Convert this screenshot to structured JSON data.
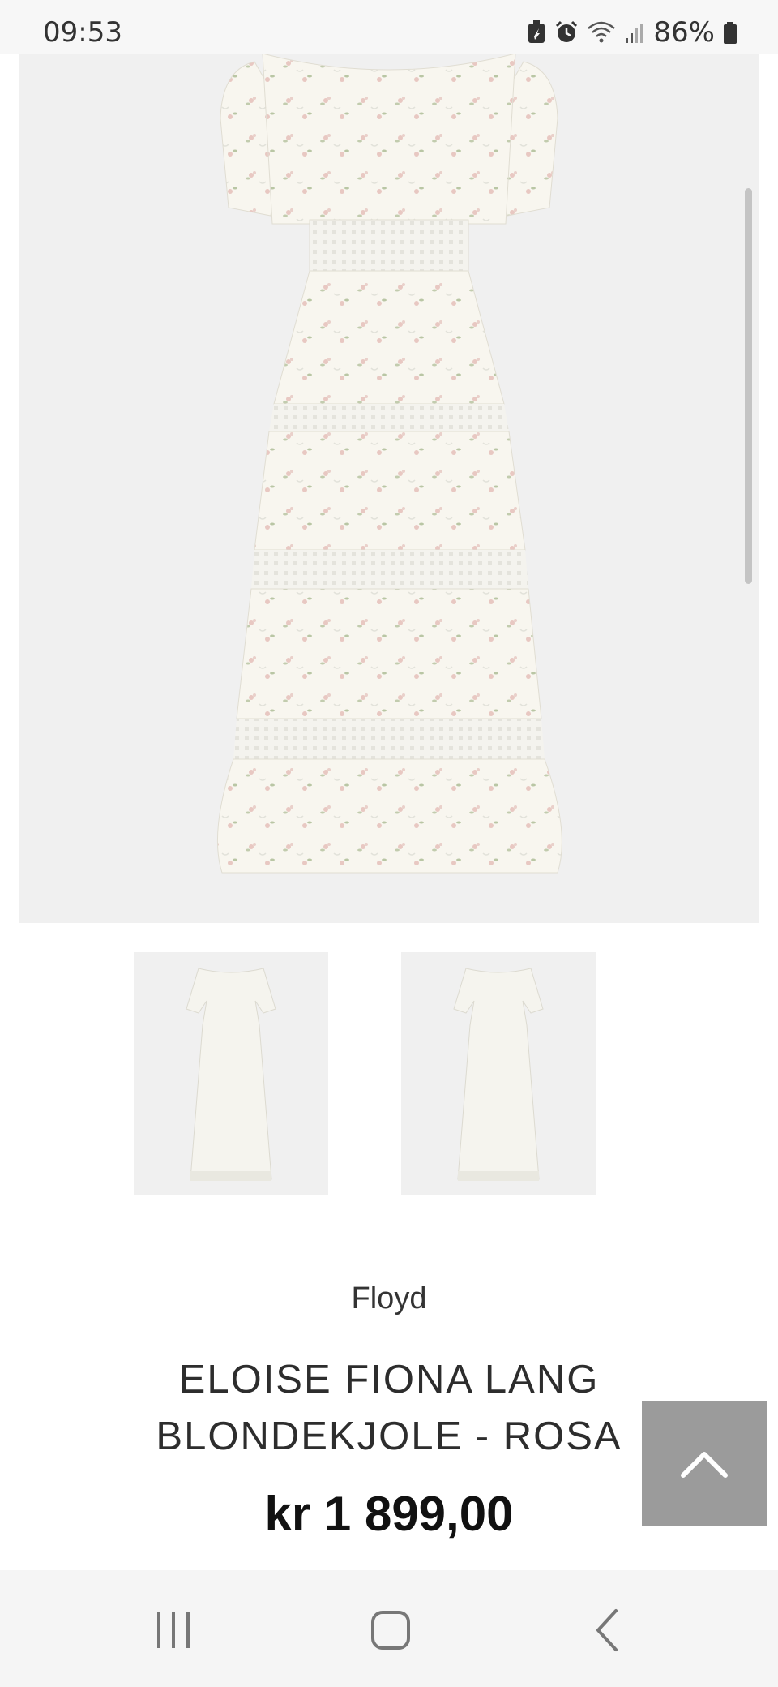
{
  "status_bar": {
    "time": "09:53",
    "battery": "86%",
    "icons": [
      "battery-saver-icon",
      "alarm-icon",
      "wifi-icon",
      "signal-icon",
      "battery-icon"
    ]
  },
  "product": {
    "brand": "Floyd",
    "title_line1": "ELOISE FIONA LANG",
    "title_line2": "BLONDEKJOLE - ROSA",
    "price": "kr 1 899,00"
  },
  "nav_bar": {
    "icons": [
      "recents-icon",
      "home-icon",
      "back-icon"
    ]
  },
  "colors": {
    "image_bg": "#f0f0f0",
    "scroll_top_bg": "#9b9b9b",
    "text": "#2d2d2d"
  }
}
